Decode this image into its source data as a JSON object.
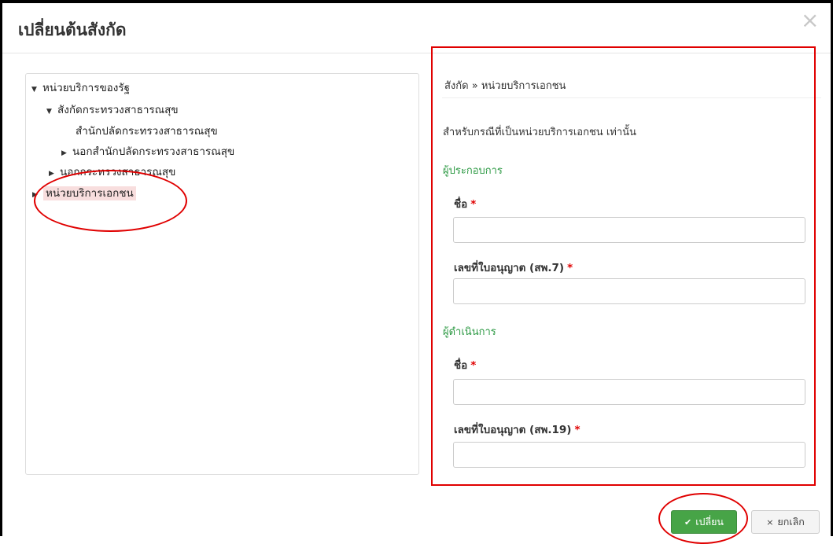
{
  "dialog": {
    "title": "เปลี่ยนต้นสังกัด",
    "close_glyph": "×"
  },
  "tree": {
    "caret_expanded": "▼",
    "caret_collapsed": "▶",
    "nodes": [
      {
        "label": "หน่วยบริการของรัฐ",
        "state": "expanded"
      },
      {
        "label": "สังกัดกระทรวงสาธารณสุข",
        "state": "expanded"
      },
      {
        "label": "สำนักปลัดกระทรวงสาธารณสุข",
        "state": "leaf"
      },
      {
        "label": "นอกสำนักปลัดกระทรวงสาธารณสุข",
        "state": "collapsed"
      },
      {
        "label": "นอกกระทรวงสาธารณสุข",
        "state": "collapsed"
      },
      {
        "label": "หน่วยบริการเอกชน",
        "state": "collapsed",
        "selected": true
      }
    ]
  },
  "form": {
    "breadcrumb": "สังกัด » หน่วยบริการเอกชน",
    "note": "สำหรับกรณีที่เป็นหน่วยบริการเอกชน เท่านั้น",
    "required_mark": "*",
    "operator": {
      "section_title": "ผู้ประกอบการ",
      "name_label": "ชื่อ",
      "name_value": "",
      "license_label": "เลขที่ใบอนุญาต (สพ.7)",
      "license_value": ""
    },
    "manager": {
      "section_title": "ผู้ดำเนินการ",
      "name_label": "ชื่อ",
      "name_value": "",
      "license_label": "เลขที่ใบอนุญาต (สพ.19)",
      "license_value": ""
    }
  },
  "footer": {
    "confirm_icon": "✔",
    "confirm_label": "เปลี่ยน",
    "cancel_icon": "×",
    "cancel_label": "ยกเลิก"
  },
  "colors": {
    "annotation_red": "#e00000",
    "section_green": "#2e9a45",
    "confirm_green": "#47a447",
    "selected_highlight": "#f8dede"
  },
  "icons": [
    "close-icon",
    "caret-down-icon",
    "caret-right-icon",
    "check-icon",
    "times-icon"
  ]
}
